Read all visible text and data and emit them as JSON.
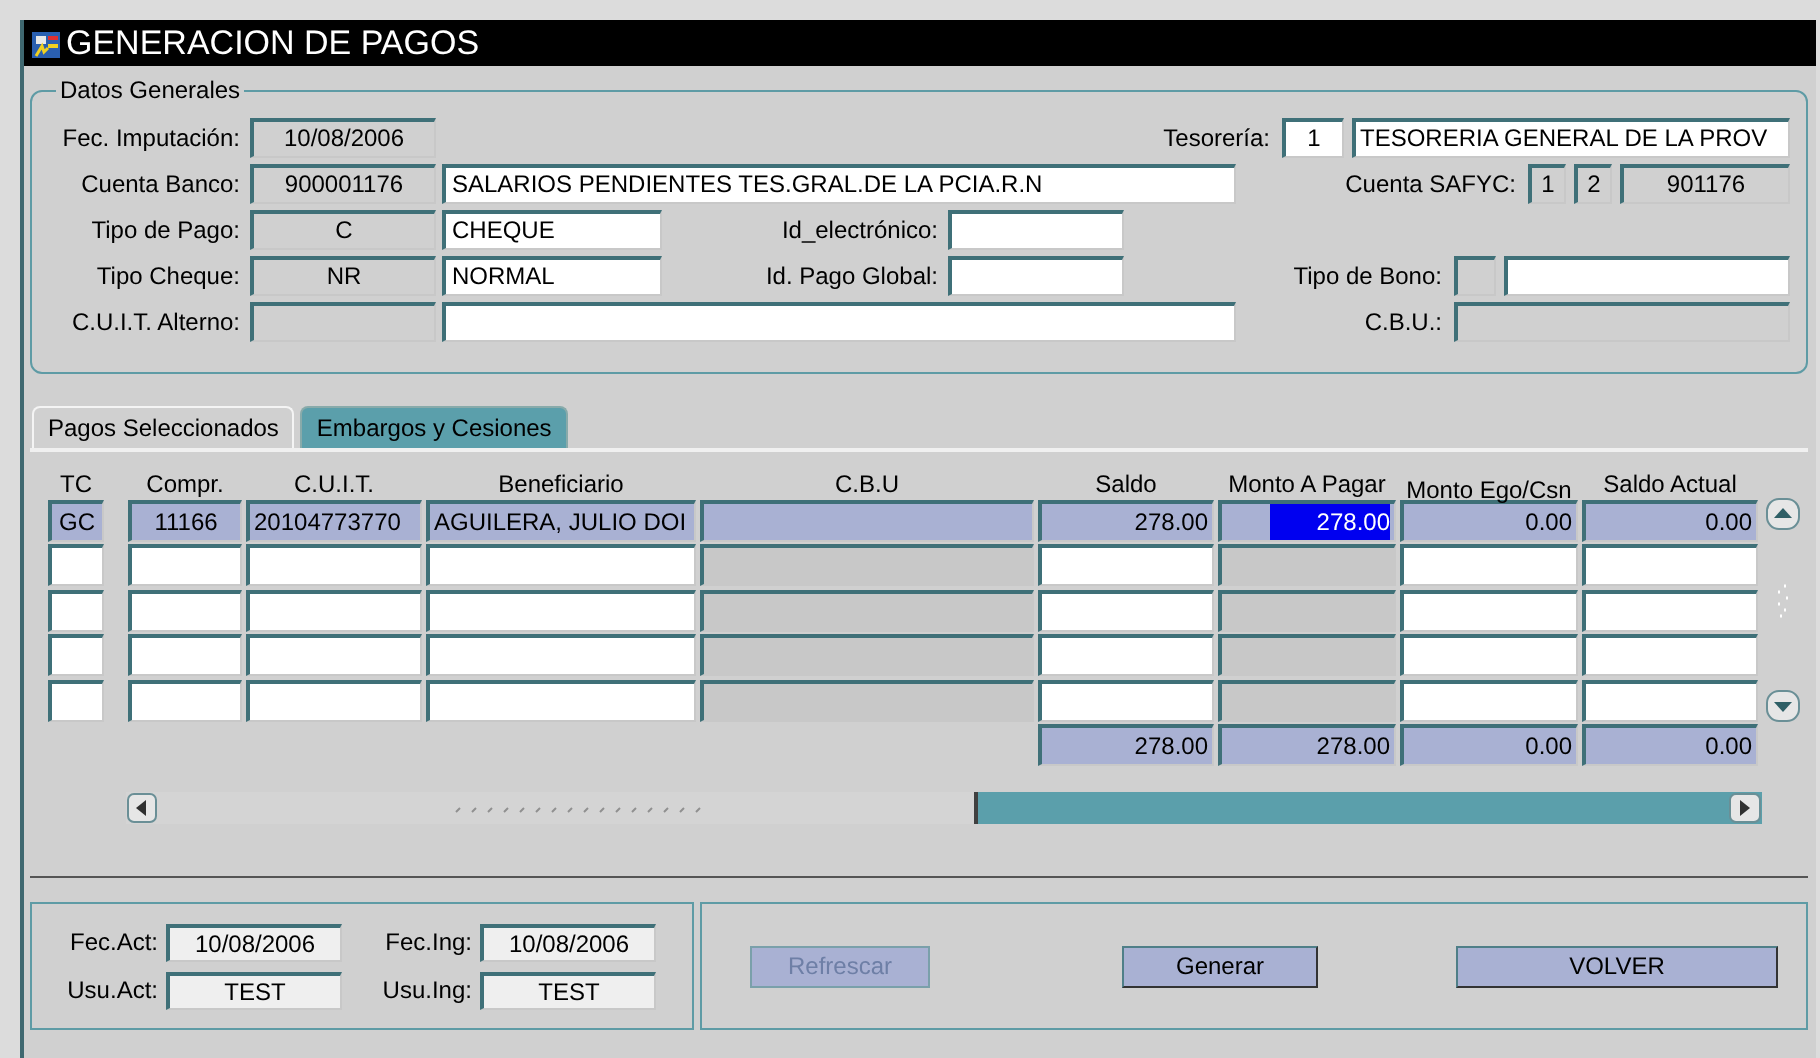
{
  "window": {
    "title": "GENERACION DE PAGOS"
  },
  "general": {
    "legend": "Datos Generales",
    "rows": [
      {
        "left": {
          "label": "Fec. Imputación:",
          "fields": [
            {
              "kind": "code",
              "value": "10/08/2006",
              "editable": false
            }
          ]
        },
        "right": {
          "label": "Tesorería:",
          "fields": [
            {
              "kind": "num",
              "value": "1",
              "editable": true
            },
            {
              "kind": "title",
              "value": "TESORERIA GENERAL DE LA PROV",
              "editable": true
            }
          ]
        }
      },
      {
        "left": {
          "label": "Cuenta Banco:",
          "fields": [
            {
              "kind": "code",
              "value": "900001176",
              "editable": false
            },
            {
              "kind": "wide",
              "value": "SALARIOS PENDIENTES TES.GRAL.DE LA PCIA.R.N",
              "editable": true
            }
          ]
        },
        "right": {
          "label": "Cuenta SAFYC:",
          "fields": [
            {
              "kind": "digit",
              "value": "1",
              "editable": false
            },
            {
              "kind": "digit",
              "value": "2",
              "editable": false
            },
            {
              "kind": "account",
              "value": "901176",
              "editable": false
            }
          ]
        }
      },
      {
        "left": {
          "label": "Tipo de Pago:",
          "fields": [
            {
              "kind": "code",
              "value": "C",
              "editable": false
            },
            {
              "kind": "name",
              "value": "CHEQUE",
              "editable": true
            }
          ]
        },
        "middle": {
          "label": "Id_electrónico:",
          "fields": [
            {
              "kind": "id",
              "editable": true
            }
          ]
        }
      },
      {
        "left": {
          "label": "Tipo Cheque:",
          "fields": [
            {
              "kind": "code",
              "value": "NR",
              "editable": false
            },
            {
              "kind": "name",
              "value": "NORMAL",
              "editable": true
            }
          ]
        },
        "middle": {
          "label": "Id. Pago Global:",
          "fields": [
            {
              "kind": "id",
              "editable": true
            }
          ]
        },
        "right": {
          "label": "Tipo de Bono:",
          "fields": [
            {
              "kind": "tiny",
              "editable": false
            },
            {
              "kind": "bono",
              "editable": true
            }
          ]
        }
      },
      {
        "left": {
          "label": "C.U.I.T. Alterno:",
          "fields": [
            {
              "kind": "code",
              "editable": false
            },
            {
              "kind": "wide",
              "editable": true
            }
          ]
        },
        "right": {
          "label": "C.B.U.:",
          "fields": [
            {
              "kind": "cbu",
              "editable": false
            }
          ]
        }
      }
    ]
  },
  "tabs": [
    {
      "label": "Pagos Seleccionados",
      "selected": true
    },
    {
      "label": "Embargos y Cesiones",
      "selected": false
    }
  ],
  "grid": {
    "columns": [
      {
        "heading": "TC",
        "editable": true
      },
      {
        "heading": "Compr.",
        "editable": true
      },
      {
        "heading": "C.U.I.T.",
        "editable": true
      },
      {
        "heading": "Beneficiario",
        "editable": true
      },
      {
        "heading": "C.B.U",
        "editable": false
      },
      {
        "heading": "Saldo",
        "editable": true
      },
      {
        "heading": "Monto A Pagar",
        "editable": false
      },
      {
        "heading": "Monto Ego/Csn",
        "editable": true
      },
      {
        "heading": "Saldo Actual",
        "editable": true
      }
    ],
    "rows": [
      {
        "selected": true,
        "cells": [
          {
            "text": "GC",
            "focused": false
          },
          {
            "text": "11166",
            "focused": false
          },
          {
            "text": "20104773770",
            "focused": false
          },
          {
            "text": "AGUILERA, JULIO DOI",
            "focused": false
          },
          {
            "focused": false
          },
          {
            "text": "278.00",
            "focused": false
          },
          {
            "text": "278.00",
            "focused": true
          },
          {
            "text": "0.00",
            "focused": false
          },
          {
            "text": "0.00",
            "focused": false
          }
        ]
      },
      {
        "selected": false
      },
      {
        "selected": false
      },
      {
        "selected": false
      },
      {
        "selected": false
      }
    ],
    "totals": [
      "278.00",
      "278.00",
      "0.00",
      "0.00"
    ]
  },
  "audit": [
    {
      "label": "Fec.Act:",
      "value": "10/08/2006"
    },
    {
      "label": "Fec.Ing:",
      "value": "10/08/2006"
    },
    {
      "label": "Usu.Act:",
      "value": "TEST"
    },
    {
      "label": "Usu.Ing:",
      "value": "TEST"
    }
  ],
  "buttons": [
    {
      "label": "Refrescar",
      "disabled": true
    },
    {
      "label": "Generar",
      "disabled": false
    },
    {
      "label": "VOLVER",
      "disabled": false
    }
  ]
}
